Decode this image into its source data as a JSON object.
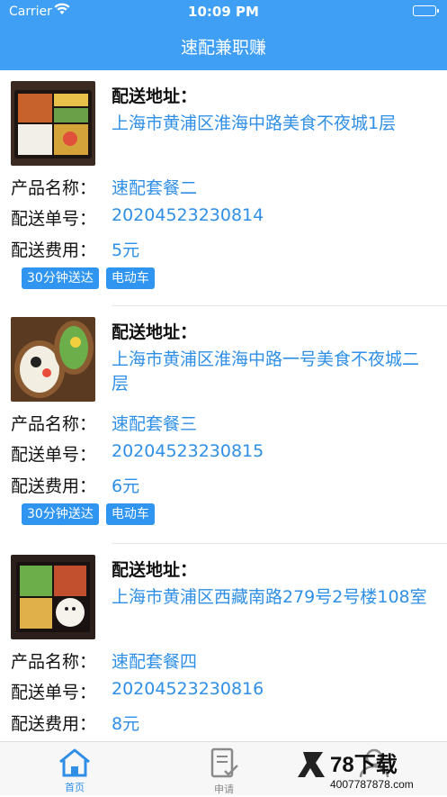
{
  "status_bar": {
    "carrier": "Carrier",
    "time": "10:09 PM"
  },
  "nav": {
    "title": "速配兼职赚"
  },
  "labels": {
    "address": "配送地址：",
    "product": "产品名称：",
    "order": "配送单号：",
    "fee": "配送费用："
  },
  "orders": [
    {
      "address": "上海市黄浦区淮海中路美食不夜城1层",
      "product": "速配套餐二",
      "order_no": "20204523230814",
      "fee": "5元",
      "tags": [
        "30分钟送达",
        "电动车"
      ]
    },
    {
      "address": "上海市黄浦区淮海中路一号美食不夜城二层",
      "product": "速配套餐三",
      "order_no": "20204523230815",
      "fee": "6元",
      "tags": [
        "30分钟送达",
        "电动车"
      ]
    },
    {
      "address": "上海市黄浦区西藏南路279号2号楼108室",
      "product": "速配套餐四",
      "order_no": "20204523230816",
      "fee": "8元",
      "tags": []
    }
  ],
  "tabbar": {
    "home": "首页",
    "apply": "申请"
  },
  "watermark": {
    "brand": "78下载",
    "site": "4007787878.com"
  },
  "colors": {
    "accent": "#3f9ff5",
    "link": "#2f8fe6",
    "tag": "#2f95f0"
  }
}
